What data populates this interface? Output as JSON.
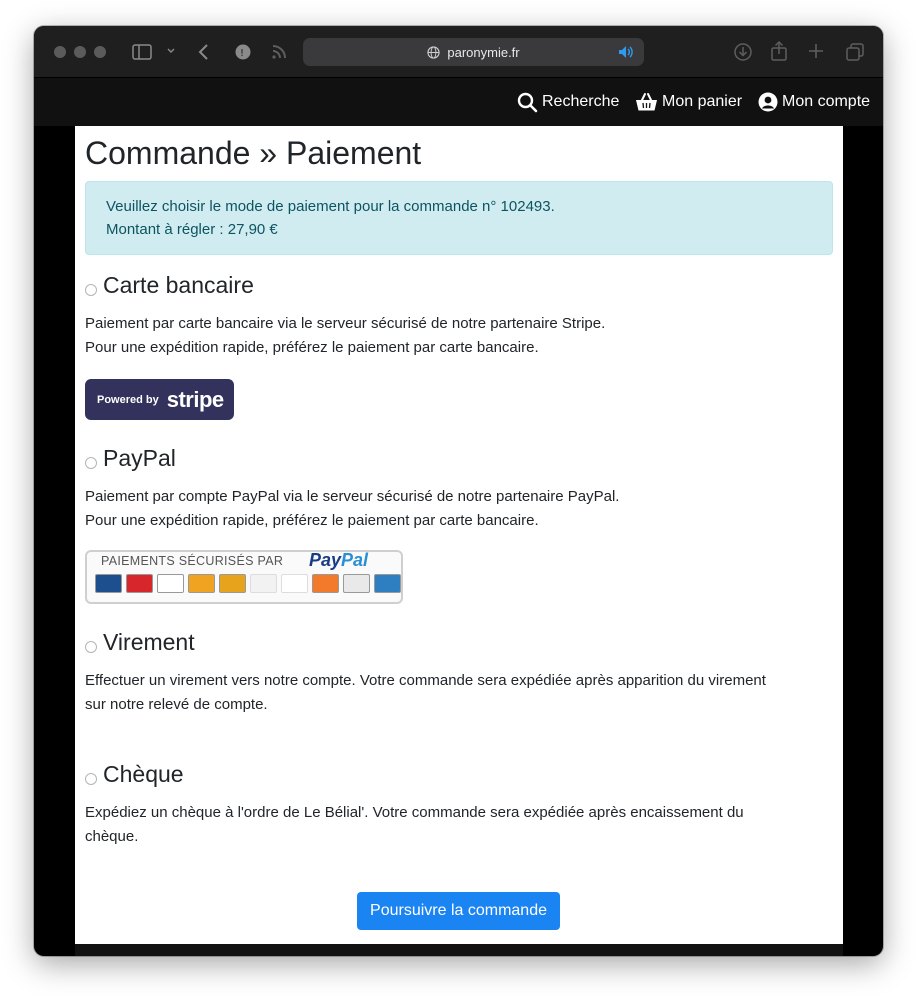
{
  "browser": {
    "url": "paronymie.fr"
  },
  "navbar": {
    "search_label": "Recherche",
    "cart_label": "Mon panier",
    "account_label": "Mon compte"
  },
  "page": {
    "title": "Commande » Paiement",
    "alert_line1": "Veuillez choisir le mode de paiement pour la commande n° 102493.",
    "alert_line2": "Montant à régler : 27,90 €"
  },
  "methods": [
    {
      "title": "Carte bancaire",
      "desc_line1": "Paiement par carte bancaire via le serveur sécurisé de notre partenaire Stripe.",
      "desc_line2": "Pour une expédition rapide, préférez le paiement par carte bancaire."
    },
    {
      "title": "PayPal",
      "desc_line1": "Paiement par compte PayPal via le serveur sécurisé de notre partenaire PayPal.",
      "desc_line2": "Pour une expédition rapide, préférez le paiement par carte bancaire."
    },
    {
      "title": "Virement",
      "desc_line1": "Effectuer un virement vers notre compte. Votre commande sera expédiée après apparition du virement",
      "desc_line2": "sur notre relevé de compte."
    },
    {
      "title": "Chèque",
      "desc_line1": "Expédiez un chèque à l'ordre de Le Bélial'. Votre commande sera expédiée après encaissement du",
      "desc_line2": "chèque."
    }
  ],
  "badges": {
    "stripe_powered": "Powered by",
    "stripe_name": "stripe",
    "paypal_head": "PAIEMENTS SÉCURISÉS PAR",
    "paypal_pay": "Pay",
    "paypal_pal": "Pal"
  },
  "submit_label": "Poursuivre la commande",
  "colors": {
    "primary": "#1b84f3",
    "alert_bg": "#d1ecf1",
    "alert_text": "#0c5460",
    "stripe": "#32325d"
  }
}
